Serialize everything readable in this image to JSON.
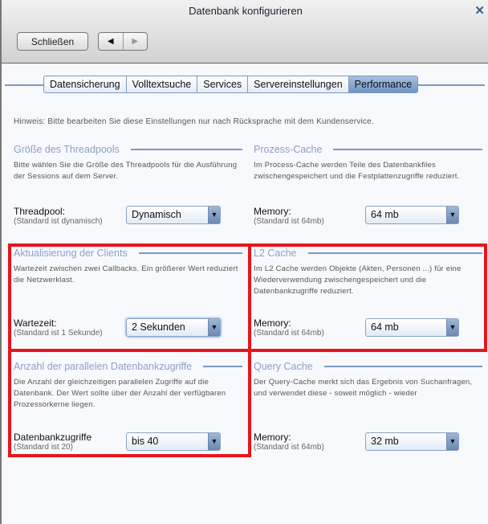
{
  "window": {
    "title": "Datenbank konfigurieren",
    "close_icon": "close-icon"
  },
  "toolbar": {
    "close_label": "Schließen",
    "back": "◀",
    "forward": "▶"
  },
  "tabs": [
    {
      "label": "Datensicherung"
    },
    {
      "label": "Volltextsuche"
    },
    {
      "label": "Services"
    },
    {
      "label": "Servereinstellungen"
    },
    {
      "label": "Performance",
      "active": true
    }
  ],
  "hint": "Hinweis: Bitte bearbeiten Sie diese Einstellungen nur nach Rücksprache mit dem Kundenservice.",
  "sections": [
    {
      "title": "Größe des Threadpools",
      "desc": "Bitte wählen Sie die Größe des Threadpools für die Ausführung der Sessions auf dem Server.",
      "label": "Threadpool:",
      "sub": "(Standard ist dynamisch)",
      "value": "Dynamisch"
    },
    {
      "title": "Prozess-Cache",
      "desc": "Im Process-Cache werden Teile des Datenbankfiles zwischengespeichert und die Festplattenzugriffe reduziert.",
      "label": "Memory:",
      "sub": "(Standard ist 64mb)",
      "value": "64 mb"
    },
    {
      "title": "Aktualisierung der Clients",
      "desc": "Wartezeit zwischen zwei Callbacks. Ein größerer Wert reduziert die Netzwerklast.",
      "label": "Wartezeit:",
      "sub": "(Standard ist 1 Sekunde)",
      "value": "2 Sekunden"
    },
    {
      "title": "L2 Cache",
      "desc": "Im L2 Cache werden Objekte (Akten, Personen ...) für eine Wiederverwendung zwischengespeichert und die Datenbankzugriffe reduziert.",
      "label": "Memory:",
      "sub": "(Standard ist 64mb)",
      "value": "64 mb"
    },
    {
      "title": "Anzahl der parallelen Datenbankzugriffe",
      "desc": "Die Anzahl der gleichzeitigen parallelen Zugriffe auf die Datenbank. Der Wert sollte über der Anzahl der verfügbaren Prozessorkerne liegen.",
      "label": "Datenbankzugriffe",
      "sub": "(Standard ist 20)",
      "value": "bis 40"
    },
    {
      "title": "Query Cache",
      "desc": "Der Query-Cache merkt sich das Ergebnis von Suchanfragen, und verwendet diese - soweit möglich - wieder",
      "label": "Memory:",
      "sub": "(Standard ist 64mb)",
      "value": "32 mb"
    }
  ],
  "colors": {
    "highlight": "#e8141e",
    "accent": "#7a9ac0",
    "section_title": "#8c9fc8"
  }
}
